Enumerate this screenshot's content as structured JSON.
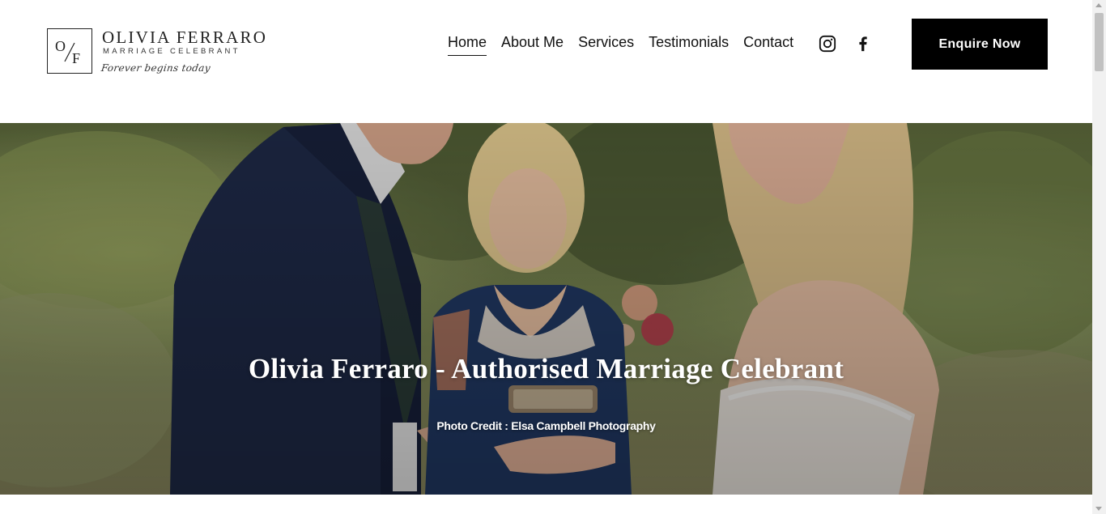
{
  "brand": {
    "monogram_left": "O",
    "monogram_right": "F",
    "name": "OLIVIA FERRARO",
    "subtitle": "MARRIAGE CELEBRANT",
    "tagline": "Forever begins today"
  },
  "nav": {
    "items": [
      {
        "label": "Home",
        "active": true
      },
      {
        "label": "About Me",
        "active": false
      },
      {
        "label": "Services",
        "active": false
      },
      {
        "label": "Testimonials",
        "active": false
      },
      {
        "label": "Contact",
        "active": false
      }
    ]
  },
  "social": {
    "instagram_icon": "instagram-icon",
    "facebook_icon": "facebook-icon"
  },
  "cta": {
    "label": "Enquire Now"
  },
  "hero": {
    "title": "Olivia Ferraro - Authorised Marriage Celebrant",
    "credit": "Photo Credit : Elsa Campbell Photography"
  },
  "colors": {
    "button_bg": "#000000",
    "button_text": "#ffffff",
    "hero_text": "#ffffff"
  }
}
